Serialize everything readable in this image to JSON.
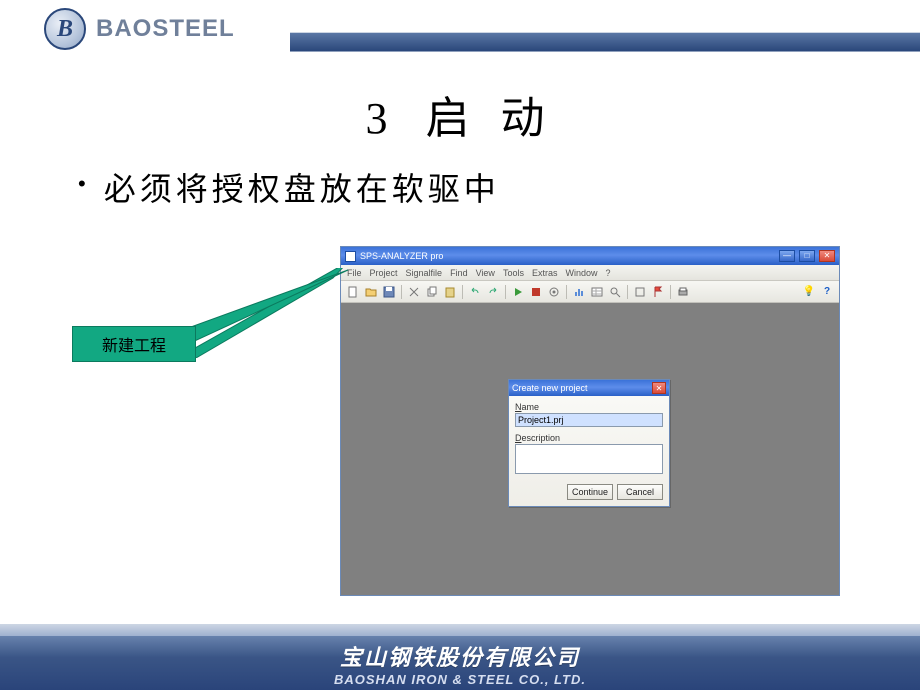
{
  "header": {
    "brand": "BAOSTEEL",
    "logoLetter": "B"
  },
  "title": {
    "number": "3",
    "text": "启 动"
  },
  "bullet": {
    "text": "必须将授权盘放在软驱中"
  },
  "callout": {
    "label": "新建工程"
  },
  "app": {
    "windowTitle": "SPS-ANALYZER pro",
    "menus": [
      "File",
      "Project",
      "Signalfile",
      "Find",
      "View",
      "Tools",
      "Extras",
      "Window",
      "?"
    ],
    "dialog": {
      "title": "Create new project",
      "nameLabel": "Name",
      "nameValue": "Project1.prj",
      "descLabel": "Description",
      "descValue": "",
      "continue": "Continue",
      "cancel": "Cancel"
    }
  },
  "footer": {
    "cn": "宝山钢铁股份有限公司",
    "en": "BAOSHAN IRON & STEEL CO., LTD."
  }
}
